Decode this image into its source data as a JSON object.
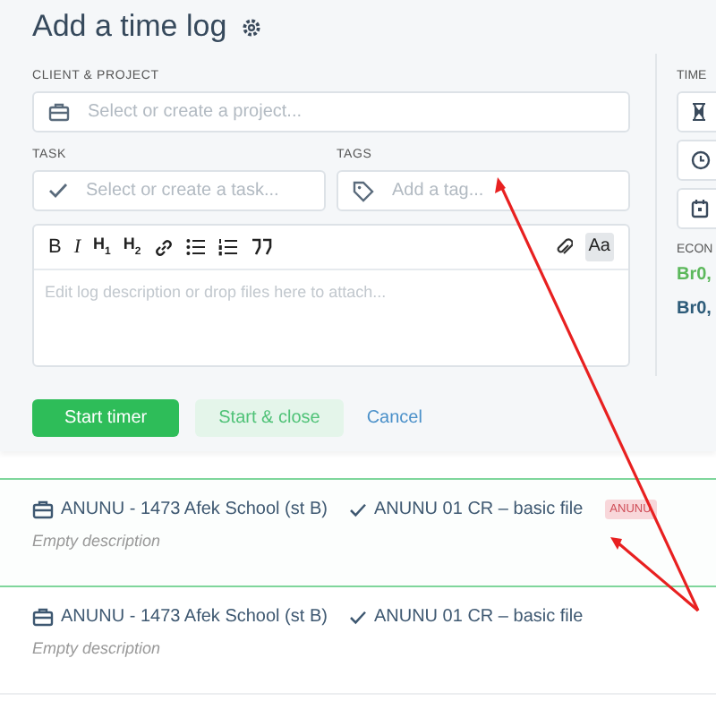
{
  "form": {
    "title": "Add a time log",
    "project": {
      "label": "CLIENT & PROJECT",
      "placeholder": "Select or create a project..."
    },
    "task": {
      "label": "TASK",
      "placeholder": "Select or create a task..."
    },
    "tags": {
      "label": "TAGS",
      "placeholder": "Add a tag..."
    },
    "toolbar": [
      {
        "kind": "bold",
        "label": "B"
      },
      {
        "kind": "italic",
        "label": "I"
      },
      {
        "kind": "heading",
        "label": "H",
        "sub": "1"
      },
      {
        "kind": "heading",
        "label": "H",
        "sub": "2"
      },
      {
        "kind": "link"
      },
      {
        "kind": "bullets"
      },
      {
        "kind": "numbers"
      },
      {
        "kind": "quote"
      }
    ],
    "toolbar_right": [
      {
        "kind": "attach"
      },
      {
        "kind": "format",
        "label": "Aa",
        "active": true
      }
    ],
    "editor": {
      "placeholder": "Edit log description or drop files here to attach..."
    },
    "buttons": [
      {
        "kind": "primary",
        "label": "Start timer"
      },
      {
        "kind": "secondary",
        "label": "Start & close"
      },
      {
        "kind": "link",
        "label": "Cancel"
      }
    ]
  },
  "side": {
    "label": "TIME",
    "fields": [
      {
        "kind": "hourglass"
      },
      {
        "kind": "clock"
      },
      {
        "kind": "calendar"
      }
    ],
    "econ_label": "ECON",
    "amounts": [
      {
        "text": "Br0,",
        "color": "#5cb85c"
      },
      {
        "text": "Br0,",
        "color": "#2e5c7a"
      }
    ]
  },
  "entries": [
    {
      "project": "ANUNU - 1473 Afek School (st B)",
      "task": "ANUNU 01 CR – basic file",
      "tag": "ANUNU",
      "description": "Empty description",
      "selected": true
    },
    {
      "project": "ANUNU - 1473 Afek School (st B)",
      "task": "ANUNU 01 CR – basic file",
      "description": "Empty description",
      "selected": false
    }
  ]
}
